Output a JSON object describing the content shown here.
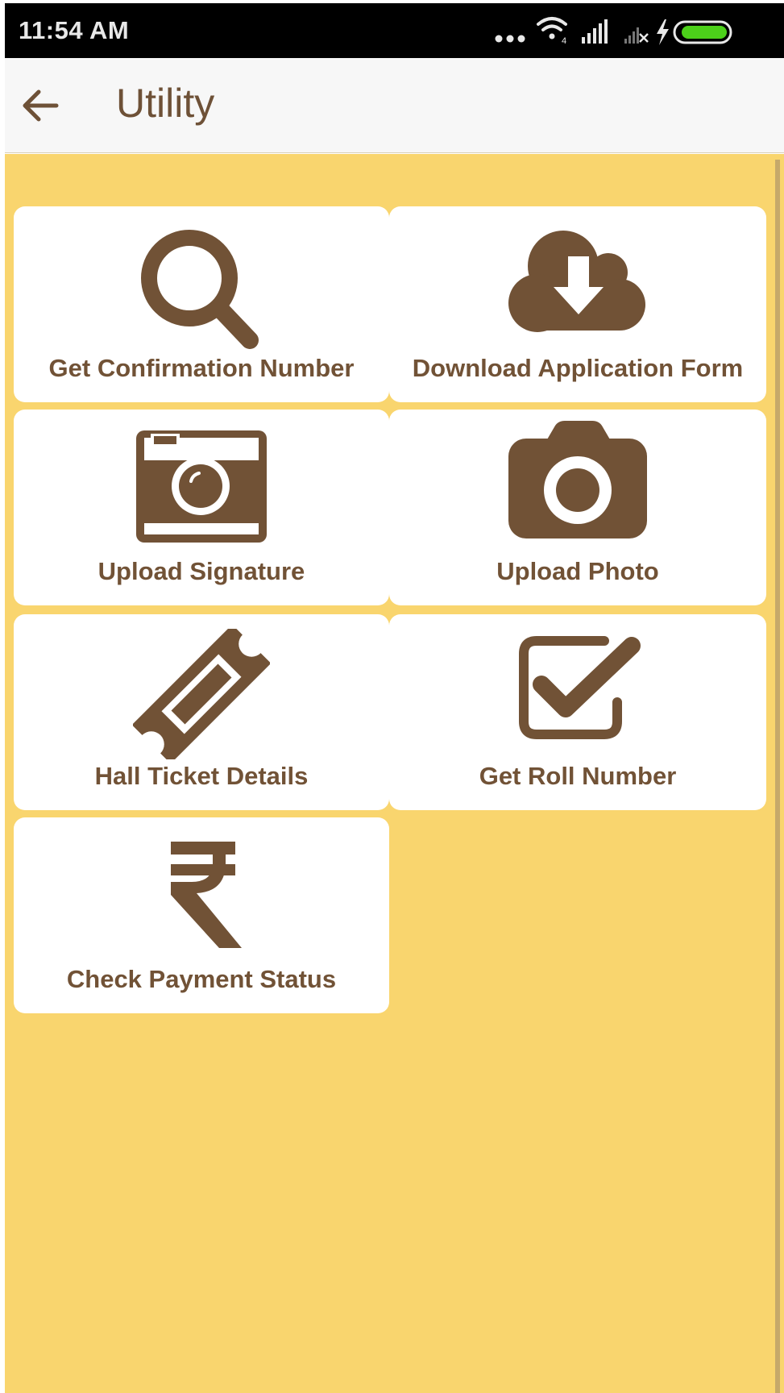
{
  "status_bar": {
    "time": "11:54 AM",
    "icons": [
      "more-dots-icon",
      "wifi-icon",
      "signal-icon",
      "no-signal-icon",
      "charging-bolt-icon",
      "battery-icon"
    ]
  },
  "app_bar": {
    "title": "Utility",
    "back_icon": "arrow-left-icon"
  },
  "colors": {
    "background": "#f9d56e",
    "tile": "#ffffff",
    "accent": "#715236",
    "battery": "#4cd11a"
  },
  "tiles": [
    {
      "label": "Get Confirmation Number",
      "icon": "search-icon"
    },
    {
      "label": "Download Application Form",
      "icon": "cloud-download-icon"
    },
    {
      "label": "Upload Signature",
      "icon": "camera-retro-icon"
    },
    {
      "label": "Upload Photo",
      "icon": "camera-icon"
    },
    {
      "label": "Hall Ticket Details",
      "icon": "ticket-icon"
    },
    {
      "label": "Get Roll Number",
      "icon": "checkbox-icon"
    },
    {
      "label": "Check Payment Status",
      "icon": "rupee-icon"
    }
  ]
}
